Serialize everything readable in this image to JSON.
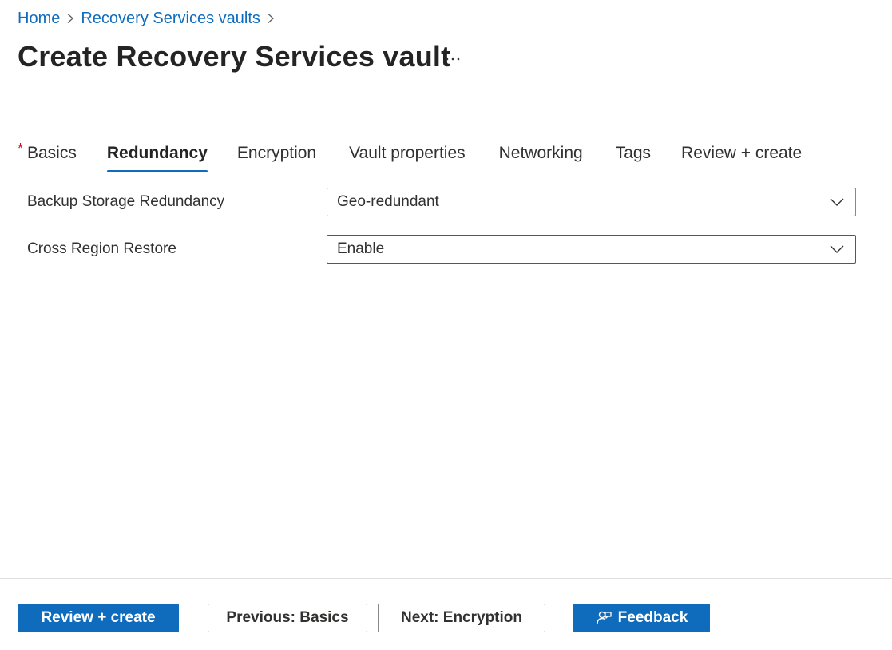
{
  "breadcrumb": {
    "items": [
      "Home",
      "Recovery Services vaults"
    ]
  },
  "page": {
    "title": "Create Recovery Services vault",
    "more_label": "···"
  },
  "tabs": [
    {
      "label": "Basics",
      "required": true,
      "active": false
    },
    {
      "label": "Redundancy",
      "required": false,
      "active": true
    },
    {
      "label": "Encryption",
      "required": false,
      "active": false
    },
    {
      "label": "Vault properties",
      "required": false,
      "active": false
    },
    {
      "label": "Networking",
      "required": false,
      "active": false
    },
    {
      "label": "Tags",
      "required": false,
      "active": false
    },
    {
      "label": "Review + create",
      "required": false,
      "active": false
    }
  ],
  "required_marker": "*",
  "form": {
    "backup_storage": {
      "label": "Backup Storage Redundancy",
      "value": "Geo-redundant"
    },
    "cross_region": {
      "label": "Cross Region Restore",
      "value": "Enable"
    }
  },
  "footer": {
    "review_create": "Review + create",
    "previous": "Previous: Basics",
    "next": "Next: Encryption",
    "feedback": "Feedback"
  },
  "colors": {
    "accent": "#0f6cbd",
    "focus_border": "#8a2da8",
    "required": "#c50f1f"
  },
  "icons": {
    "breadcrumb_separator": "chevron-right-icon",
    "dropdown": "chevron-down-icon",
    "more": "more-icon",
    "feedback": "feedback-icon"
  }
}
